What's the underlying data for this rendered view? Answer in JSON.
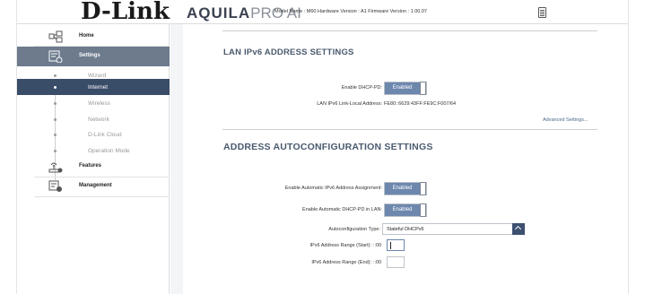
{
  "header": {
    "brand": "D-Link",
    "product_bold": "AQUILA",
    "product_light": "PRO AI",
    "model_info": "Model Name : M60 Hardware Version : A1 Firmware Version : 1.00.07"
  },
  "sidebar": {
    "items": [
      {
        "label": "Home",
        "icon": "home-network-icon"
      },
      {
        "label": "Settings",
        "icon": "settings-icon"
      },
      {
        "label": "Features",
        "icon": "features-icon"
      },
      {
        "label": "Management",
        "icon": "management-icon"
      }
    ],
    "settings_sub": [
      "Wizard",
      "Internet",
      "Wireless",
      "Network",
      "D-Link Cloud",
      "Operation Mode"
    ],
    "active_sub": "Internet"
  },
  "lan": {
    "title": "LAN IPv6 ADDRESS SETTINGS",
    "dhcp_pd_label": "Enable DHCP-PD:",
    "dhcp_pd_state": "Enabled",
    "link_local_label": "LAN IPv6 Link-Local Address:",
    "link_local_value": "FE80::6629:43FF:FE9C:F007/64",
    "advanced_link": "Advanced Settings..."
  },
  "autoconf": {
    "title": "ADDRESS AUTOCONFIGURATION SETTINGS",
    "auto_assign_label": "Enable Automatic IPv6 Address Assignment:",
    "auto_assign_state": "Enabled",
    "auto_pd_label": "Enable Automatic DHCP-PD in LAN:",
    "auto_pd_state": "Enabled",
    "type_label": "Autoconfiguration Type:",
    "type_value": "Stateful DHCPv6",
    "range_start_label": "IPv6 Address Range (Start):",
    "range_start_prefix": "::00",
    "range_start_value": "",
    "range_end_label": "IPv6 Address Range (End):",
    "range_end_prefix": "::00",
    "range_end_value": ""
  },
  "colors": {
    "sidebar_active": "#3a4d68",
    "settings_active": "#6d7b8d",
    "toggle_on": "#6d87ad",
    "heading": "#4a5a6e"
  }
}
